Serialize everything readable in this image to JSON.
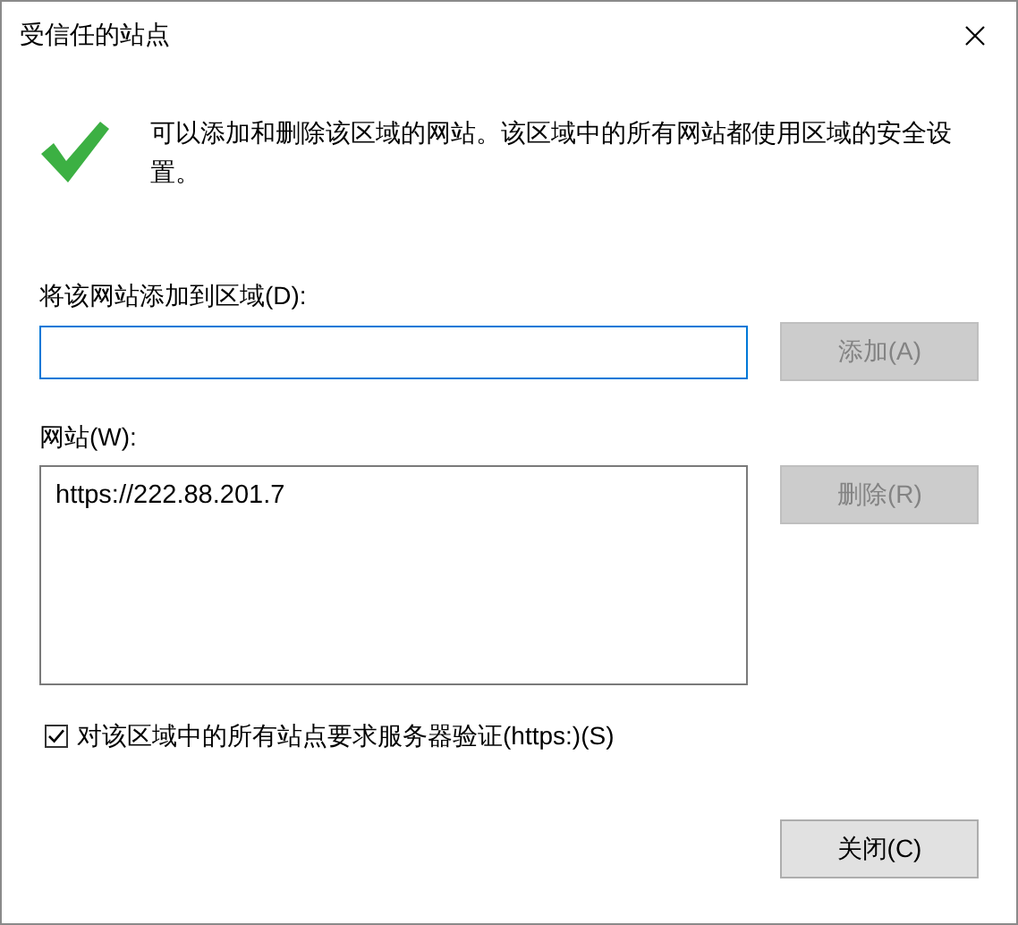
{
  "window": {
    "title": "受信任的站点"
  },
  "info": {
    "text": "可以添加和删除该区域的网站。该区域中的所有网站都使用区域的安全设置。"
  },
  "add_site": {
    "label": "将该网站添加到区域(D):",
    "focused": true
  },
  "add_button": {
    "label": "添加(A)",
    "disabled": true
  },
  "websites": {
    "label": "网站(W):",
    "items": [
      {
        "text": "https://222.88.201.7",
        "selected": false
      }
    ]
  },
  "remove_button": {
    "label": "删除(R)",
    "disabled": true
  },
  "require_https": {
    "label": "对该区域中的所有站点要求服务器验证(https:)(S)",
    "checked": true
  },
  "buttons": [
    {
      "label": "关闭(C)",
      "disabled": false
    }
  ]
}
